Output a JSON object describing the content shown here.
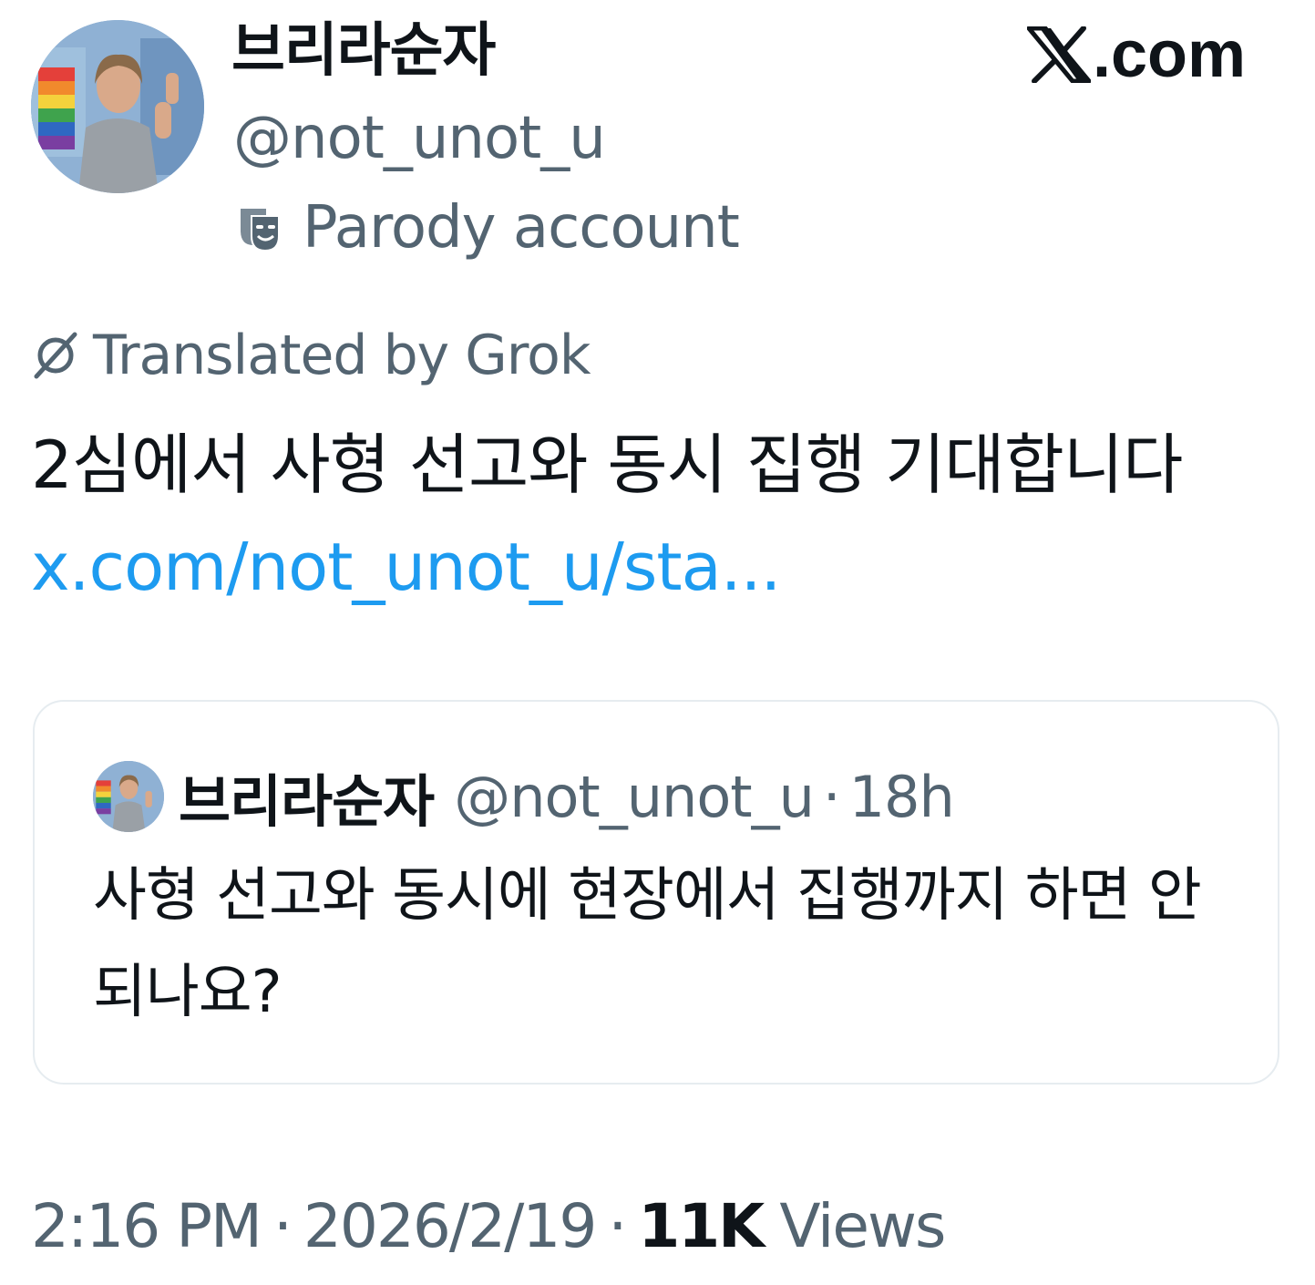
{
  "brand": {
    "label": ".com"
  },
  "tweet": {
    "display_name": "브리라순자",
    "handle": "@not_unot_u",
    "parody_label": "Parody account",
    "translated_label": "Translated by Grok",
    "text": "2심에서 사형 선고와 동시 집행 기대합니다 ",
    "link": "x.com/not_unot_u/sta..."
  },
  "quoted_tweet": {
    "display_name": "브리라순자",
    "handle": "@not_unot_u",
    "separator": "·",
    "time": "18h",
    "text": "사형 선고와 동시에 현장에서 집행까지 하면 안되나요?"
  },
  "footer": {
    "time": "2:16 PM",
    "separator": "·",
    "date": "2026/2/19",
    "views_count": "11K",
    "views_label": "Views"
  },
  "colors": {
    "text": "#0f1419",
    "secondary": "#536471",
    "link": "#1d9bf0",
    "border": "#e6ecf0"
  },
  "icons": {
    "parody": "theater-mask-icon",
    "grok": "grok-icon",
    "brand": "x-logo-icon"
  }
}
